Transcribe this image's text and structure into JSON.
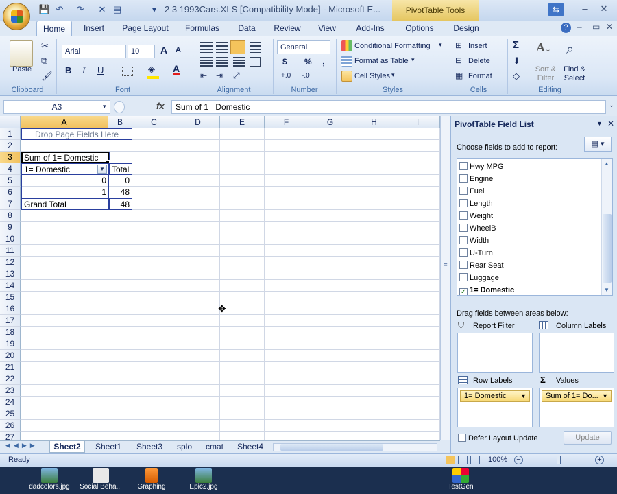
{
  "window": {
    "title": "2 3 1993Cars.XLS  [Compatibility Mode] - Microsoft E...",
    "context_tab": "PivotTable Tools"
  },
  "tabs": [
    "Home",
    "Insert",
    "Page Layout",
    "Formulas",
    "Data",
    "Review",
    "View",
    "Add-Ins",
    "Options",
    "Design"
  ],
  "ribbon": {
    "clipboard": {
      "paste": "Paste",
      "label": "Clipboard"
    },
    "font": {
      "name": "Arial",
      "size": "10",
      "label": "Font",
      "bold": "B",
      "italic": "I",
      "underline": "U",
      "grow": "A",
      "shrink": "A",
      "fontcolor": "A"
    },
    "alignment": {
      "label": "Alignment"
    },
    "number": {
      "format": "General",
      "currency": "$",
      "percent": "%",
      "comma": ",",
      "label": "Number",
      "inc": "+.0",
      "dec": "-.0"
    },
    "styles": {
      "conditional": "Conditional Formatting",
      "table": "Format as Table",
      "cell": "Cell Styles",
      "label": "Styles"
    },
    "cells": {
      "insert": "Insert",
      "delete": "Delete",
      "format": "Format",
      "label": "Cells"
    },
    "editing": {
      "sigma": "Σ",
      "sort": "Sort &",
      "sort2": "Filter",
      "find": "Find &",
      "find2": "Select",
      "label": "Editing"
    }
  },
  "formula_bar": {
    "namebox": "A3",
    "fx": "fx",
    "content": "Sum of 1= Domestic"
  },
  "sheet": {
    "columns": [
      "A",
      "B",
      "C",
      "D",
      "E",
      "F",
      "G",
      "H",
      "I"
    ],
    "rows": [
      "1",
      "2",
      "3",
      "4",
      "5",
      "6",
      "7",
      "8",
      "9",
      "10",
      "11",
      "12",
      "13",
      "14",
      "15",
      "16",
      "17",
      "18",
      "19",
      "20",
      "21",
      "22",
      "23",
      "24",
      "25",
      "26",
      "27"
    ],
    "page_fields": "Drop Page Fields Here",
    "pivot_header": "Sum of 1= Domestic",
    "row_label": "1= Domestic",
    "total_label": "Total",
    "r5": {
      "a": "0",
      "b": "0"
    },
    "r6": {
      "a": "1",
      "b": "48"
    },
    "grand": {
      "a": "Grand Total",
      "b": "48"
    }
  },
  "sheet_tabs": [
    "Sheet2",
    "Sheet1",
    "Sheet3",
    "splo",
    "cmat",
    "Sheet4"
  ],
  "status": {
    "ready": "Ready",
    "zoom": "100%"
  },
  "pivot_panel": {
    "title": "PivotTable Field List",
    "choose": "Choose fields to add to report:",
    "fields": [
      {
        "name": "Hwy MPG",
        "checked": false
      },
      {
        "name": "Engine",
        "checked": false
      },
      {
        "name": "Fuel",
        "checked": false
      },
      {
        "name": "Length",
        "checked": false
      },
      {
        "name": "Weight",
        "checked": false
      },
      {
        "name": "WheelB",
        "checked": false
      },
      {
        "name": "Width",
        "checked": false
      },
      {
        "name": "U-Turn",
        "checked": false
      },
      {
        "name": "Rear Seat",
        "checked": false
      },
      {
        "name": "Luggage",
        "checked": false
      },
      {
        "name": "1= Domestic",
        "checked": true
      }
    ],
    "drag_text": "Drag fields between areas below:",
    "report_filter": "Report Filter",
    "column_labels": "Column Labels",
    "row_labels": "Row Labels",
    "values": "Values",
    "row_chip": "1= Domestic",
    "values_chip": "Sum of 1= Do...",
    "defer": "Defer Layout Update",
    "update": "Update"
  },
  "taskbar": [
    "dadcolors.jpg",
    "Social Beha...",
    "Graphing",
    "Epic2.jpg",
    "TestGen"
  ]
}
